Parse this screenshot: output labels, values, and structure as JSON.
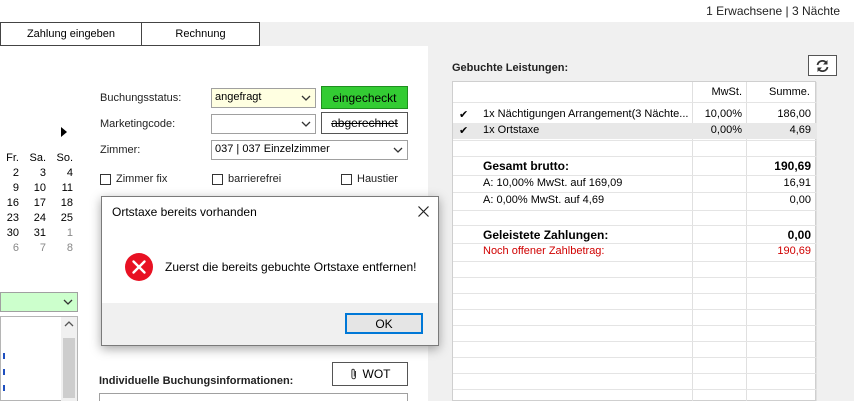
{
  "header": {
    "guest_info": "1 Erwachsene | 3 Nächte"
  },
  "tabs": [
    {
      "label": "Zahlung eingeben"
    },
    {
      "label": "Rechnung"
    }
  ],
  "booking": {
    "status_label": "Buchungsstatus:",
    "status_value": "angefragt",
    "checked_in_button": "eingecheckt",
    "marketing_label": "Marketingcode:",
    "marketing_value": "",
    "settled_button": "abgerechnet",
    "room_label": "Zimmer:",
    "room_value": "037 | 037 Einzelzimmer",
    "options": [
      {
        "label": "Zimmer fix"
      },
      {
        "label": "barrierefrei"
      },
      {
        "label": "Haustier"
      }
    ],
    "individual_info_label": "Individuelle Buchungsinformationen:",
    "wot_button": "WOT"
  },
  "calendar": {
    "headers": [
      "Fr.",
      "Sa.",
      "So."
    ],
    "rows": [
      [
        "2",
        "3",
        "4"
      ],
      [
        "9",
        "10",
        "11"
      ],
      [
        "16",
        "17",
        "18"
      ],
      [
        "23",
        "24",
        "25"
      ],
      [
        "30",
        "31",
        "1"
      ],
      [
        "6",
        "7",
        "8"
      ]
    ]
  },
  "services": {
    "title": "Gebuchte Leistungen:",
    "col_vat": "MwSt.",
    "col_sum": "Summe.",
    "items": [
      {
        "check": "✔",
        "name": "1x Nächtigungen  Arrangement(3 Nächte...",
        "vat": "10,00%",
        "sum": "186,00"
      },
      {
        "check": "✔",
        "name": "1x Ortstaxe",
        "vat": "0,00%",
        "sum": "4,69"
      }
    ],
    "total_label": "Gesamt brutto:",
    "total_value": "190,69",
    "tax_lines": [
      {
        "label": "A: 10,00% MwSt. auf 169,09",
        "value": "16,91"
      },
      {
        "label": "A: 0,00% MwSt. auf 4,69",
        "value": "0,00"
      }
    ],
    "paid_label": "Geleistete Zahlungen:",
    "paid_value": "0,00",
    "open_label": "Noch offener Zahlbetrag:",
    "open_value": "190,69",
    "open_color": "#d00000"
  },
  "dialog": {
    "title": "Ortstaxe bereits vorhanden",
    "message": "Zuerst die bereits gebuchte Ortstaxe entfernen!",
    "ok_button": "OK",
    "icon": "error-icon"
  }
}
